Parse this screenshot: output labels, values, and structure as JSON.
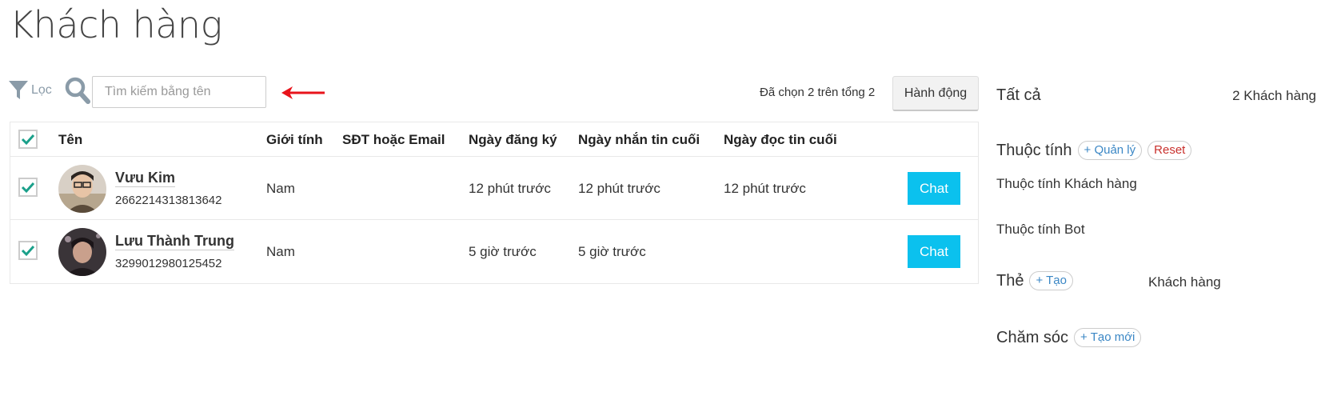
{
  "page": {
    "title": "Khách hàng"
  },
  "toolbar": {
    "filter_label": "Lọc",
    "search_placeholder": "Tìm kiếm bằng tên",
    "search_value": "",
    "selected_text": "Đã chọn 2 trên tổng 2",
    "action_label": "Hành động"
  },
  "table": {
    "headers": [
      "Tên",
      "Giới tính",
      "SĐT hoặc Email",
      "Ngày đăng ký",
      "Ngày nhắn tin cuối",
      "Ngày đọc tin cuối"
    ],
    "select_all_checked": true,
    "rows": [
      {
        "checked": true,
        "name": "Vưu Kim",
        "id": "2662214313813642",
        "gender": "Nam",
        "contact": "",
        "registered": "12 phút trước",
        "last_message": "12 phút trước",
        "last_read": "12 phút trước",
        "action": "Chat"
      },
      {
        "checked": true,
        "name": "Lưu Thành Trung",
        "id": "3299012980125452",
        "gender": "Nam",
        "contact": "",
        "registered": "5 giờ trước",
        "last_message": "5 giờ trước",
        "last_read": "",
        "action": "Chat"
      }
    ]
  },
  "right_panel": {
    "all_label": "Tất cả",
    "all_count": "2 Khách hàng",
    "attributes": {
      "title": "Thuộc tính",
      "manage_label": "+ Quản lý",
      "reset_label": "Reset",
      "items": [
        "Thuộc tính Khách hàng",
        "Thuộc tính Bot"
      ]
    },
    "tags": {
      "title": "Thẻ",
      "create_label": "+ Tạo",
      "items": [
        "Khách hàng"
      ]
    },
    "care": {
      "title": "Chăm sóc",
      "create_label": "+ Tạo mới"
    }
  },
  "colors": {
    "accent": "#0bc1ee",
    "check": "#1aa08a",
    "arrow": "#e8131b",
    "link": "#3b87c5",
    "reset": "#c9302c"
  }
}
